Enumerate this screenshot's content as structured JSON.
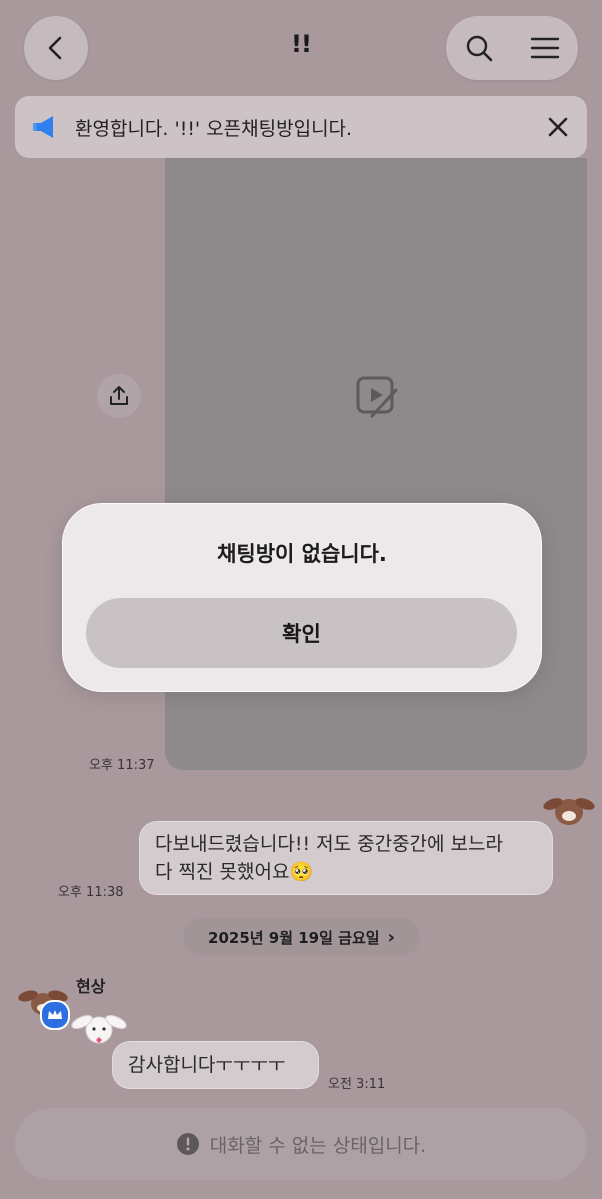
{
  "header": {
    "title": "!!"
  },
  "notice": {
    "text": "환영합니다. '!!' 오픈채팅방입니다."
  },
  "messages": [
    {
      "time": "오후 11:37"
    },
    {
      "text_line1": "다보내드렸습니다!! 저도 중간중간에 보느라",
      "text_line2": "다 찍진 못했어요🥺",
      "time": "오후 11:38"
    }
  ],
  "date_divider": {
    "label": "2025년 9월 19일 금요일",
    "chevron": "›"
  },
  "incoming": {
    "sender": "현상",
    "text": "감사합니다ㅜㅜㅜㅜ",
    "time": "오전 3:11"
  },
  "bottom_bar": {
    "text": "대화할 수 없는 상태입니다."
  },
  "dialog": {
    "message": "채팅방이 없습니다.",
    "confirm_label": "확인"
  },
  "colors": {
    "notice_icon": "#2f80ed",
    "badge": "#2d6fe0"
  }
}
